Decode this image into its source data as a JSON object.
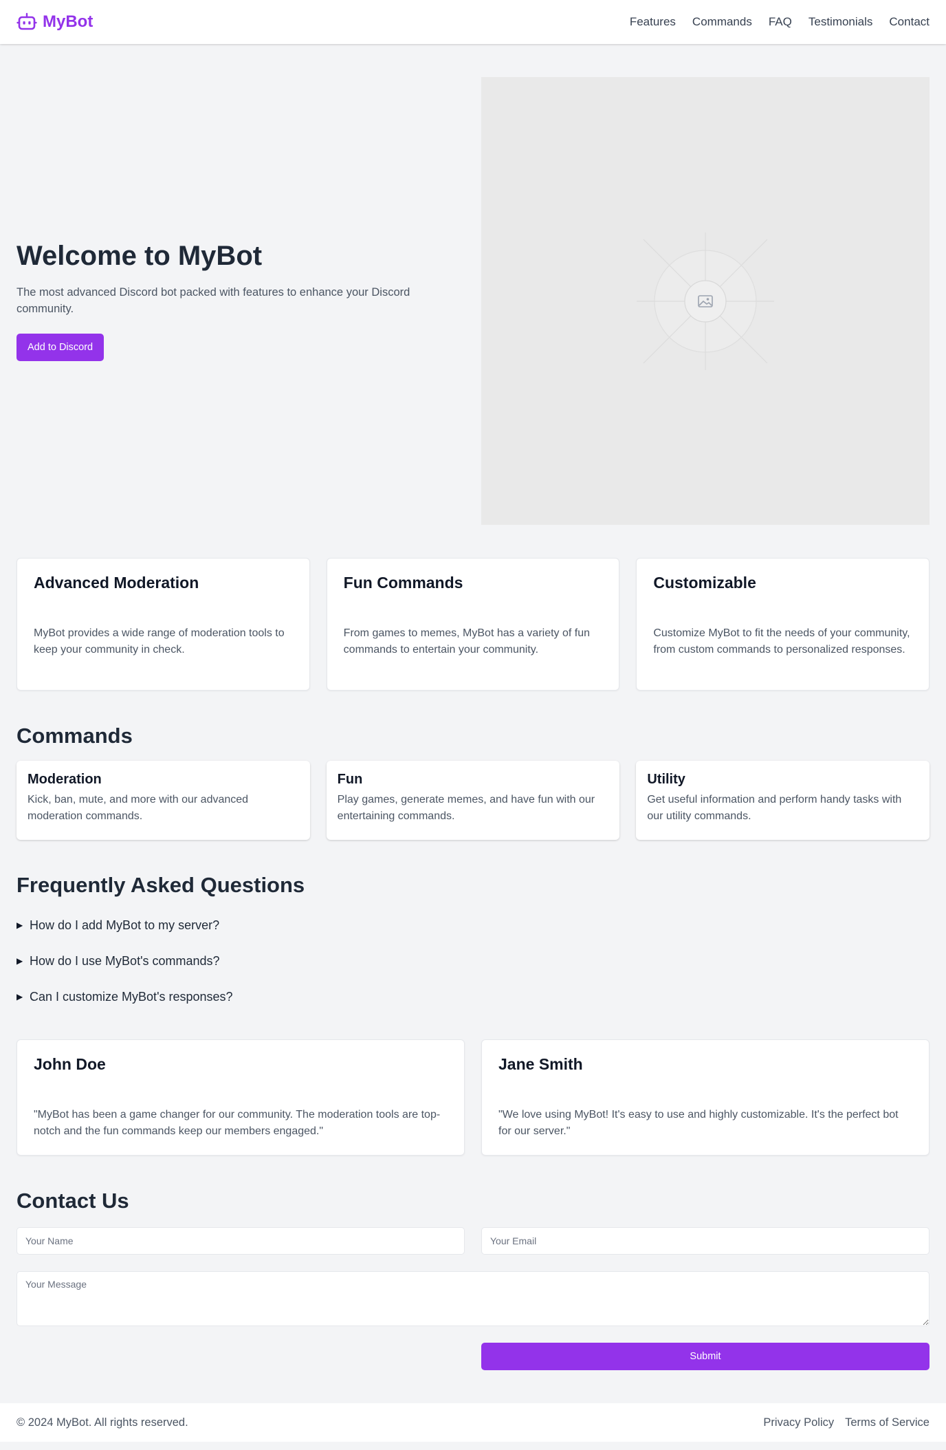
{
  "brand": {
    "name": "MyBot",
    "icon": "robot-icon",
    "color": "#9333ea"
  },
  "nav": [
    {
      "label": "Features"
    },
    {
      "label": "Commands"
    },
    {
      "label": "FAQ"
    },
    {
      "label": "Testimonials"
    },
    {
      "label": "Contact"
    }
  ],
  "hero": {
    "title": "Welcome to MyBot",
    "subtitle": "The most advanced Discord bot packed with features to enhance your Discord community.",
    "cta_label": "Add to Discord",
    "image_icon": "image-placeholder-icon"
  },
  "features": [
    {
      "title": "Advanced Moderation",
      "description": "MyBot provides a wide range of moderation tools to keep your community in check."
    },
    {
      "title": "Fun Commands",
      "description": "From games to memes, MyBot has a variety of fun commands to entertain your community."
    },
    {
      "title": "Customizable",
      "description": "Customize MyBot to fit the needs of your community, from custom commands to personalized responses."
    }
  ],
  "commands": {
    "title": "Commands",
    "items": [
      {
        "title": "Moderation",
        "description": "Kick, ban, mute, and more with our advanced moderation commands."
      },
      {
        "title": "Fun",
        "description": "Play games, generate memes, and have fun with our entertaining commands."
      },
      {
        "title": "Utility",
        "description": "Get useful information and perform handy tasks with our utility commands."
      }
    ]
  },
  "faq": {
    "title": "Frequently Asked Questions",
    "items": [
      {
        "question": "How do I add MyBot to my server?"
      },
      {
        "question": "How do I use MyBot's commands?"
      },
      {
        "question": "Can I customize MyBot's responses?"
      }
    ]
  },
  "testimonials": [
    {
      "name": "John Doe",
      "quote": "\"MyBot has been a game changer for our community. The moderation tools are top-notch and the fun commands keep our members engaged.\""
    },
    {
      "name": "Jane Smith",
      "quote": "\"We love using MyBot! It's easy to use and highly customizable. It's the perfect bot for our server.\""
    }
  ],
  "contact": {
    "title": "Contact Us",
    "name_placeholder": "Your Name",
    "email_placeholder": "Your Email",
    "message_placeholder": "Your Message",
    "submit_label": "Submit"
  },
  "footer": {
    "copyright": "© 2024 MyBot. All rights reserved.",
    "links": [
      {
        "label": "Privacy Policy"
      },
      {
        "label": "Terms of Service"
      }
    ]
  }
}
